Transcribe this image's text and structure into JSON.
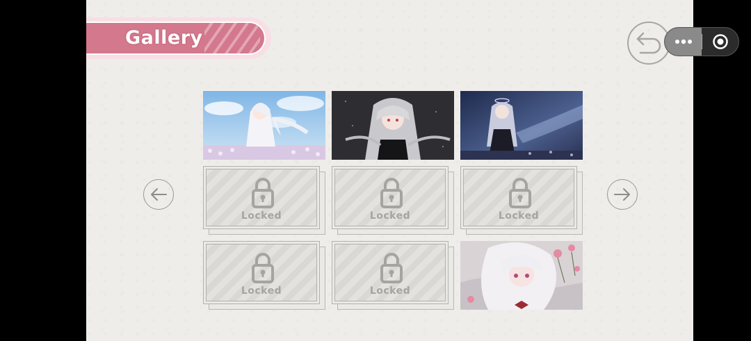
{
  "header": {
    "title": "Gallery"
  },
  "grid": {
    "locked_label": "Locked",
    "tiles": [
      {
        "state": "unlocked",
        "scene": "blue-sky-flower-field"
      },
      {
        "state": "unlocked",
        "scene": "dark-petals"
      },
      {
        "state": "unlocked",
        "scene": "night-storm"
      },
      {
        "state": "locked"
      },
      {
        "state": "locked"
      },
      {
        "state": "locked"
      },
      {
        "state": "locked"
      },
      {
        "state": "locked"
      },
      {
        "state": "unlocked",
        "scene": "roses-lying"
      }
    ]
  },
  "icons": {
    "back": "undo-arrow-icon",
    "prev": "arrow-left-icon",
    "next": "arrow-right-icon",
    "lock": "padlock-icon",
    "more": "more-dots-icon",
    "record": "record-target-icon"
  },
  "colors": {
    "banner": "#d4788d",
    "banner_outer": "#f7dfe5",
    "background": "#efedea",
    "locked_text": "#a6a4a0"
  }
}
